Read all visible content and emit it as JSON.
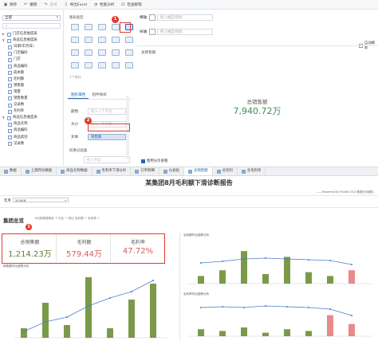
{
  "toolbar": {
    "items": [
      {
        "icon": "save-icon",
        "label": "保存"
      },
      {
        "icon": "undo-icon",
        "label": "撤销"
      },
      {
        "icon": "redo-icon",
        "label": "重做"
      },
      {
        "icon": "export-icon",
        "label": "导出Excel"
      },
      {
        "icon": "performance-icon",
        "label": "性能分析"
      },
      {
        "icon": "check-icon",
        "label": "检查解锁"
      }
    ]
  },
  "left_panel": {
    "select_value": "全部",
    "tree": [
      {
        "label": "门店信息维度表",
        "type": "folder",
        "collapsed": true
      },
      {
        "label": "商品信息维度表",
        "type": "folder",
        "collapsed": false
      },
      {
        "label": "日期(年月日)",
        "type": "field"
      },
      {
        "label": "门店编码",
        "type": "field"
      },
      {
        "label": "门店",
        "type": "field"
      },
      {
        "label": "商品编码",
        "type": "field"
      },
      {
        "label": "成本额",
        "type": "field"
      },
      {
        "label": "毛利额",
        "type": "field"
      },
      {
        "label": "销售额",
        "type": "field"
      },
      {
        "label": "销量",
        "type": "field"
      },
      {
        "label": "销售数量",
        "type": "field"
      },
      {
        "label": "记录数",
        "type": "field"
      },
      {
        "label": "毛利率",
        "type": "field"
      },
      {
        "label": "商品信息维度表",
        "type": "folder",
        "collapsed": false
      },
      {
        "label": "商品名称",
        "type": "field"
      },
      {
        "label": "商品编码",
        "type": "field"
      },
      {
        "label": "商品类别",
        "type": "field"
      },
      {
        "label": "记录数",
        "type": "field"
      }
    ]
  },
  "middle_panel": {
    "section_title": "图表类型",
    "hint": "1个指标",
    "tabs": [
      "图形属性",
      "组件样式"
    ],
    "props": [
      {
        "label": "颜色",
        "value": "拖入一个字段"
      },
      {
        "label": "大小",
        "value": "拖入一个字段"
      },
      {
        "label": "文本",
        "value": "销售额"
      }
    ],
    "filter_title": "结果过滤器",
    "filter_placeholder": "拖入字段"
  },
  "right_panel": {
    "fields": [
      {
        "label": "横轴",
        "placeholder": "拖入维度/指标"
      },
      {
        "label": "纵轴",
        "placeholder": "拖入维度/指标"
      }
    ],
    "auto_refresh": "自动刷新",
    "widget_title": "总销售额",
    "kpi_label": "总销售额",
    "kpi_value": "7,940.72万",
    "checkbox_label": "使用分页查看"
  },
  "tabs": [
    {
      "label": "数据",
      "active": false
    },
    {
      "label": "上期月份数据",
      "active": false
    },
    {
      "label": "商品名称数据",
      "active": false
    },
    {
      "label": "毛利率下滑分析",
      "active": false
    },
    {
      "label": "订单明细",
      "active": false
    },
    {
      "label": "仪表板",
      "active": false
    },
    {
      "label": "总销售额",
      "active": true
    },
    {
      "label": "总毛利",
      "active": false
    },
    {
      "label": "总毛利率",
      "active": false
    }
  ],
  "report": {
    "title": "某集团8月毛利额下滑诊断报告",
    "powered": "——Powered By FineBI V5.0 数据分析团队",
    "filter_label": "年月",
    "filter_value": "2018-8",
    "section_title": "集团总览",
    "section_note": "8月销售额指标 ↑ 环比 ↑ 同比 毛利额 ↑ 毛利率 ↑",
    "kpis": [
      {
        "label": "总销售额",
        "value": "1,214.23万",
        "color": "#5a7f2e"
      },
      {
        "label": "毛利额",
        "value": "579.44万",
        "color": "#e05a5a"
      },
      {
        "label": "毛利率",
        "value": "47.72%",
        "color": "#e05a5a"
      }
    ],
    "chart1_title": "销售额环比趋势分析",
    "chart2_title": "毛利额环比趋势分析",
    "chart3_title": "毛利率环比趋势分析"
  },
  "badges": [
    "1",
    "2",
    "3"
  ],
  "colors": {
    "accent": "#2a64b3",
    "red_highlight": "#e03a2f",
    "bar_green": "#7a9a4a",
    "bar_pink": "#e98a8a",
    "line_blue": "#4a7fd0"
  }
}
